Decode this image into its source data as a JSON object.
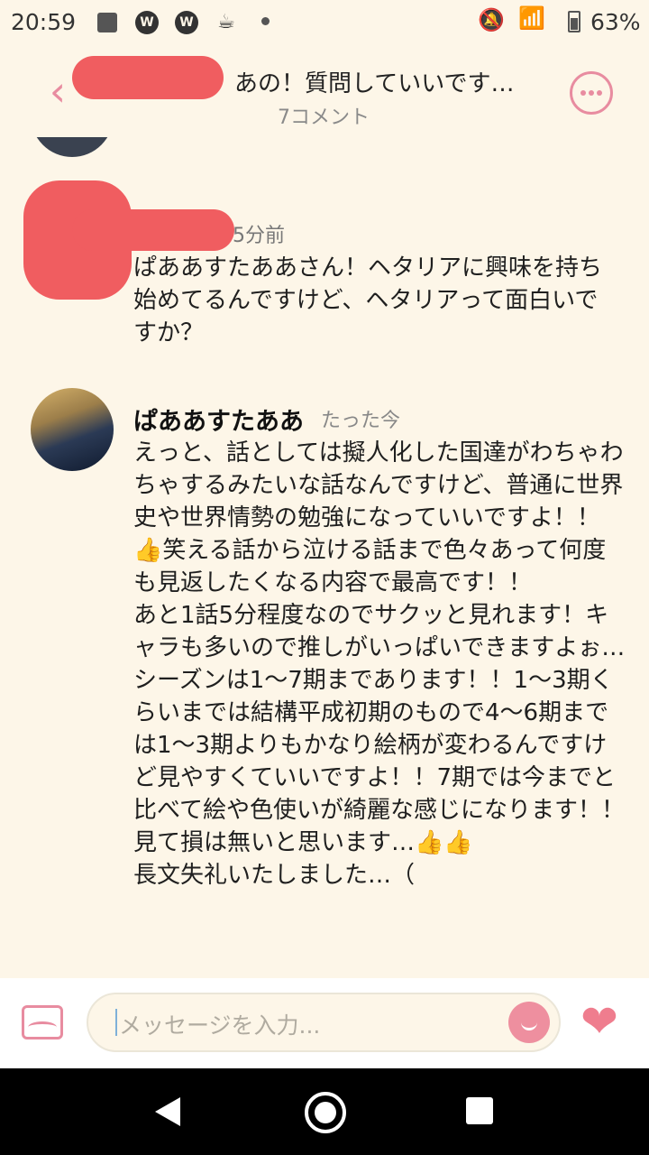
{
  "status_bar": {
    "time": "20:59",
    "app_icon_a": "W",
    "app_icon_b": "W",
    "battery_percent": "63%",
    "icons": [
      "image-icon",
      "app-icon",
      "app-icon",
      "cup-icon",
      "dot-icon",
      "bell-off-icon",
      "wifi-icon",
      "battery-icon"
    ]
  },
  "header": {
    "title": "あの！質問していいです…",
    "subtitle": "7コメント",
    "back_icon": "chevron-left-icon",
    "more_icon": "more-icon"
  },
  "messages": [
    {
      "time": "5分前",
      "text": "ぱああすたああさん！ヘタリアに興味を持ち始めてるんですけど、ヘタリアって面白いですか？"
    },
    {
      "author": "ぱああすたああ",
      "time": "たった今",
      "text": "えっと、話としては擬人化した国達がわちゃわちゃするみたいな話なんですけど、普通に世界史や世界情勢の勉強になっていいですよ！！👍笑える話から泣ける話まで色々あって何度も見返したくなる内容で最高です！！\nあと1話5分程度なのでサクッと見れます！キャラも多いので推しがいっぱいできますよぉ…\nシーズンは1〜7期まであります！！1〜3期くらいまでは結構平成初期のもので4〜6期までは1〜3期よりもかなり絵柄が変わるんですけど見やすくていいですよ！！7期では今までと比べて絵や色使いが綺麗な感じになります！！\n見て損は無いと思います…👍👍\n長文失礼いたしました…（"
    }
  ],
  "previous_snippet": "",
  "input": {
    "placeholder": "メッセージを入力..."
  },
  "colors": {
    "background": "#fdf6e8",
    "accent_pink": "#e88ca0",
    "redaction": "#f05d60",
    "heart": "#ef7d8e"
  }
}
